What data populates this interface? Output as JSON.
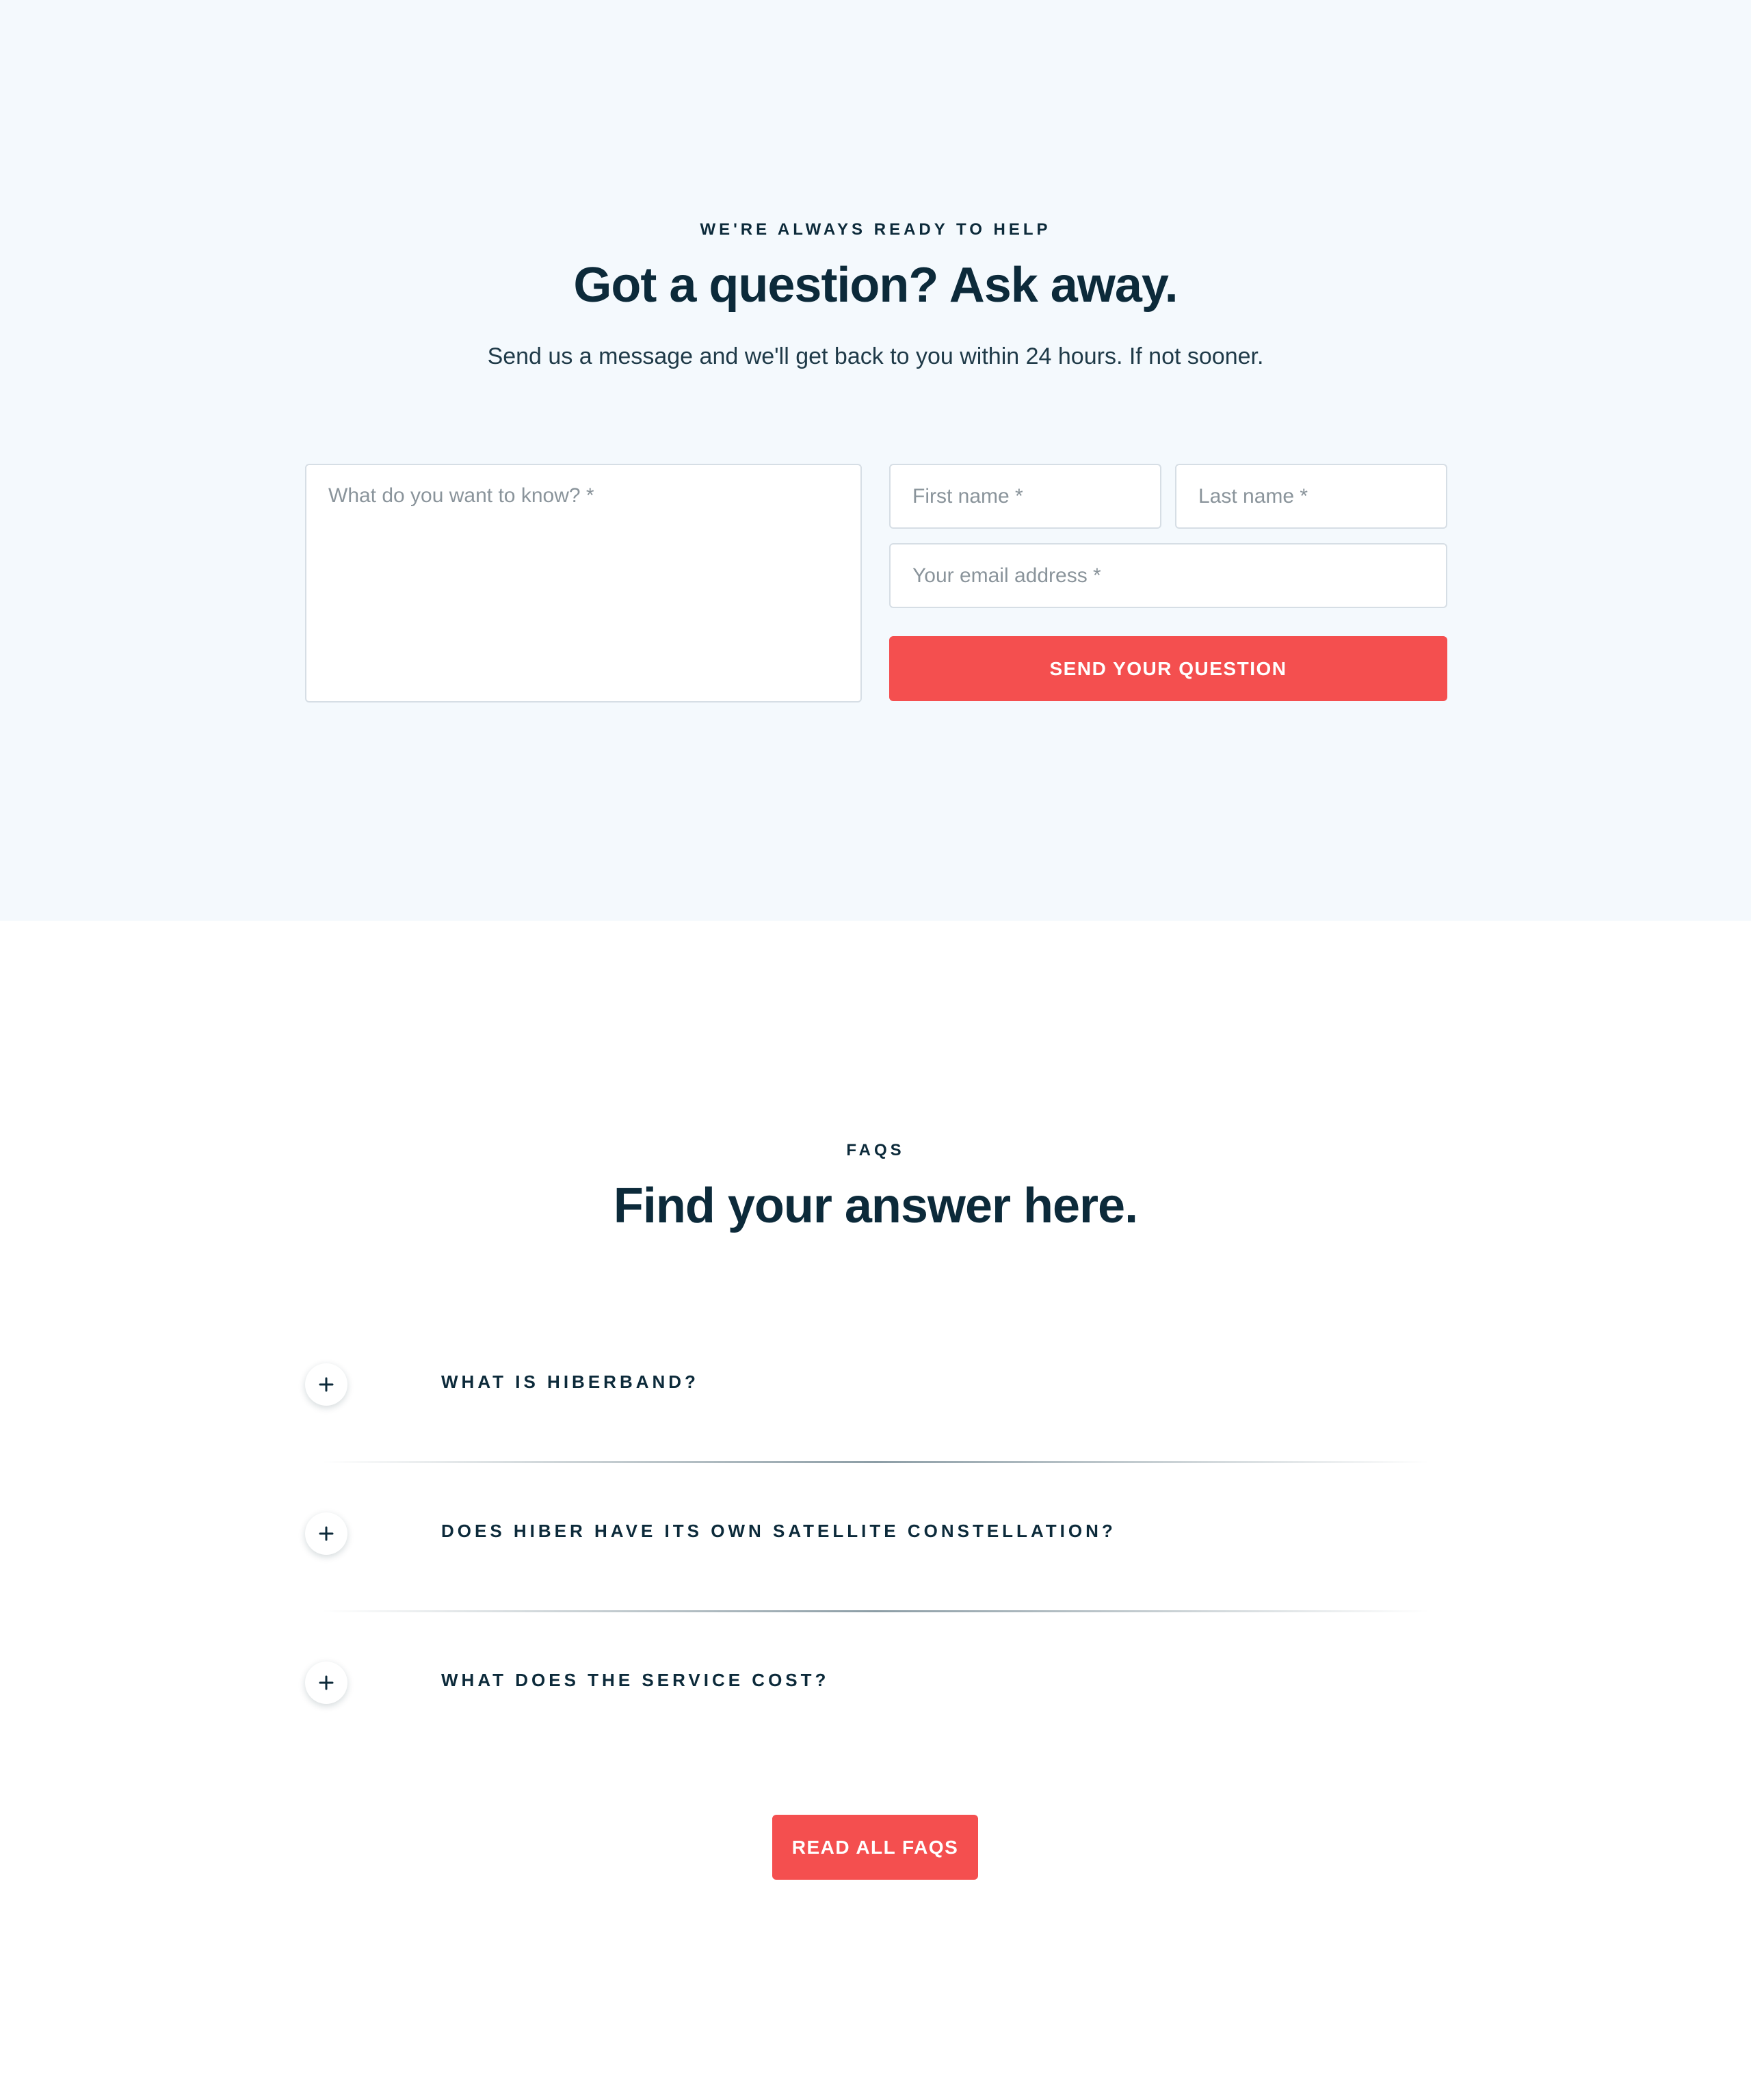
{
  "contact": {
    "eyebrow": "WE'RE ALWAYS READY TO HELP",
    "title": "Got a question? Ask away.",
    "subtitle": "Send us a message and we'll get back to you within 24 hours. If not sooner.",
    "form": {
      "question_placeholder": "What do you want to know? *",
      "first_name_placeholder": "First name *",
      "last_name_placeholder": "Last name *",
      "email_placeholder": "Your email address *",
      "submit_label": "SEND YOUR QUESTION"
    }
  },
  "faq": {
    "eyebrow": "FAQS",
    "title": "Find your answer here.",
    "items": [
      {
        "question": "WHAT IS HIBERBAND?"
      },
      {
        "question": "DOES HIBER HAVE ITS OWN SATELLITE CONSTELLATION?"
      },
      {
        "question": "WHAT DOES THE SERVICE COST?"
      }
    ],
    "button_label": "READ ALL FAQS"
  },
  "colors": {
    "accent": "#f44f4f",
    "text_dark": "#0c2a3a",
    "section_bg": "#f4f9fd"
  },
  "icons": {
    "faq_toggle": "plus-icon"
  }
}
